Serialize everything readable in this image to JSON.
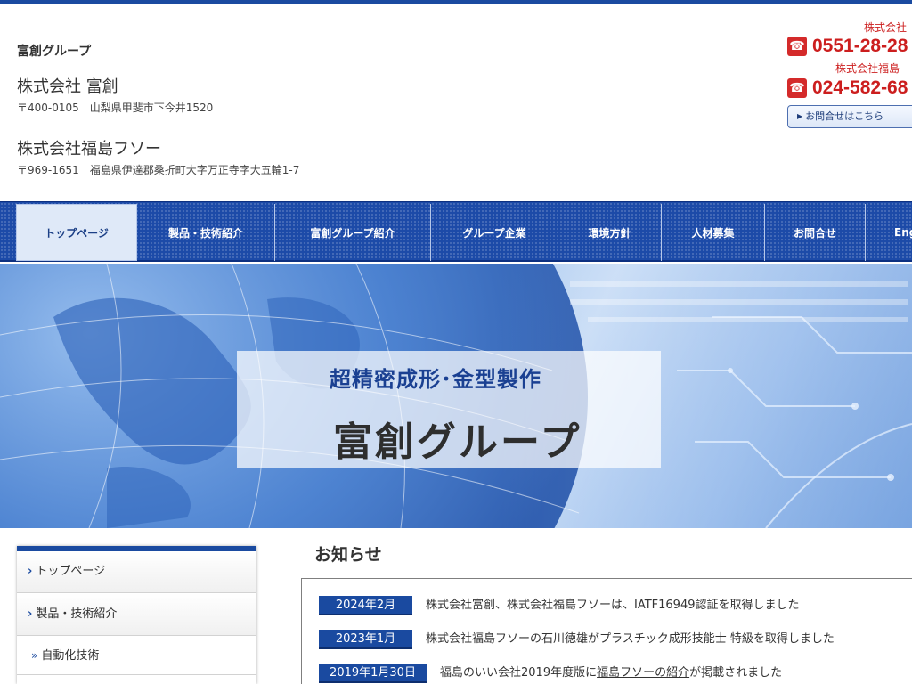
{
  "header": {
    "group_name": "富創グループ",
    "company1": {
      "name": "株式会社 富創",
      "address": "〒400-0105　山梨県甲斐市下今井1520"
    },
    "company2": {
      "name": "株式会社福島フソー",
      "address": "〒969-1651　福島県伊達郡桑折町大字万正寺字大五輪1-7"
    }
  },
  "contact": {
    "label1": "株式会社",
    "phone1": "0551-28-28",
    "label2": "株式会社福島",
    "phone2": "024-582-68",
    "inquiry_label": "お問合せはこちら"
  },
  "nav": {
    "items": [
      {
        "label": "トップページ"
      },
      {
        "label": "製品・技術紹介"
      },
      {
        "label": "富創グループ紹介"
      },
      {
        "label": "グループ企業"
      },
      {
        "label": "環境方針"
      },
      {
        "label": "人材募集"
      },
      {
        "label": "お問合せ"
      },
      {
        "label": "Eng"
      }
    ]
  },
  "hero": {
    "tagline": "超精密成形･金型製作",
    "title": "富創グループ"
  },
  "sidebar": {
    "items": [
      {
        "label": "トップページ"
      },
      {
        "label": "製品・技術紹介"
      },
      {
        "label": "自動化技術"
      }
    ]
  },
  "news": {
    "heading": "お知らせ",
    "items": [
      {
        "date": "2024年2月",
        "text": "株式会社富創、株式会社福島フソーは、IATF16949認証を取得しました"
      },
      {
        "date": "2023年1月",
        "text": "株式会社福島フソーの石川徳雄がプラスチック成形技能士 特級を取得しました"
      },
      {
        "date": "2019年1月30日",
        "text_before": "福島のいい会社2019年度版に",
        "link": "福島フソーの紹介",
        "text_after": "が掲載されました"
      }
    ]
  },
  "colors": {
    "brand_blue": "#1a4aa0",
    "phone_red": "#cc1e1e"
  },
  "icons": {
    "phone": "phone-icon",
    "chevron": "chevron-right-icon"
  }
}
